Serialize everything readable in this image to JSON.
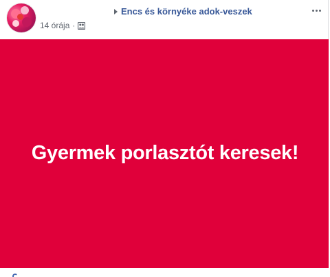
{
  "post": {
    "group_name": "Encs és környéke adok-veszek",
    "timestamp": "14 órája",
    "separator": "·",
    "audience_icon": "group-audience-icon",
    "more_icon": "more-options-icon",
    "image_text": "Gyermek porlasztót keresek!",
    "colors": {
      "image_background": "#e0003a",
      "image_text": "#ffffff",
      "group_link": "#385898",
      "meta_text": "#616770"
    }
  }
}
